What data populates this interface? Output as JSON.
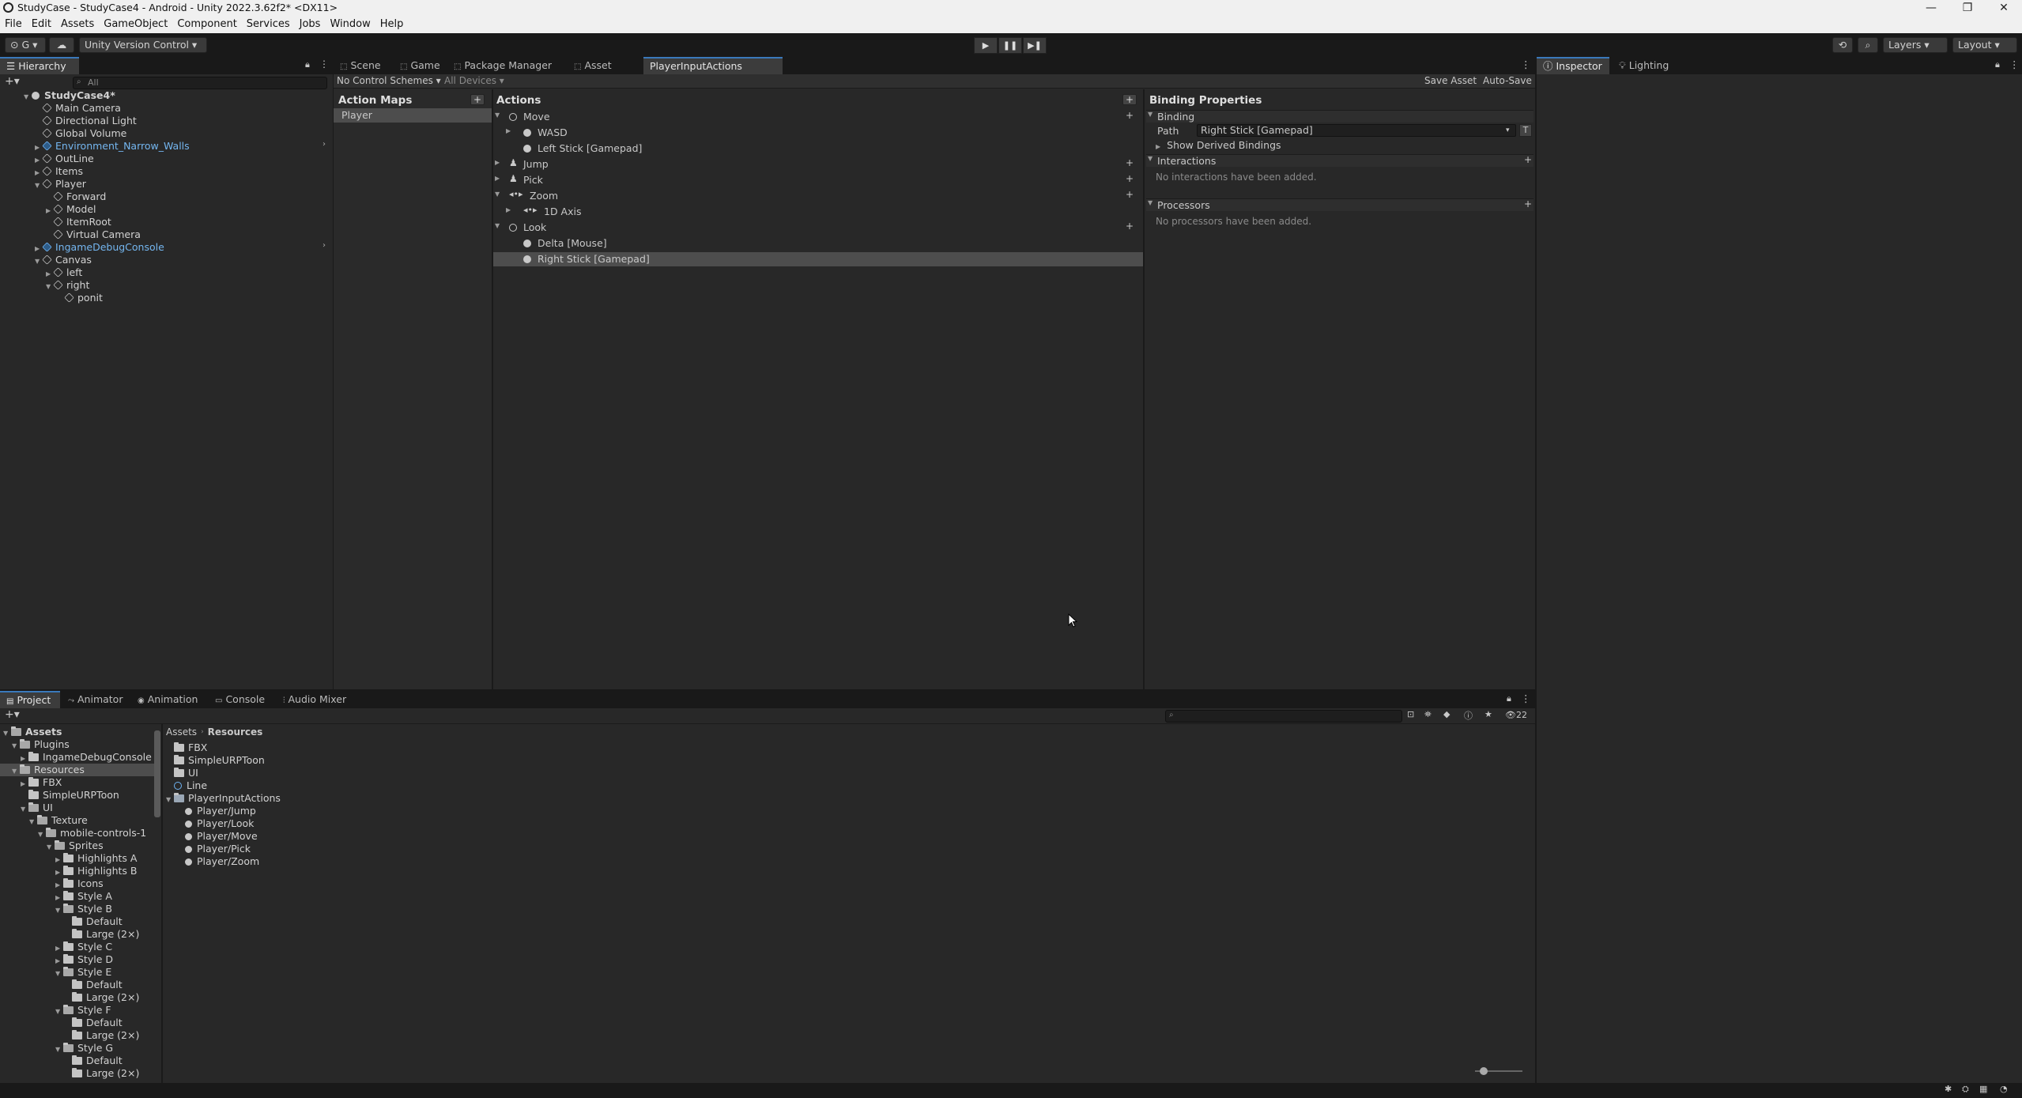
{
  "window": {
    "title": "StudyCase - StudyCase4 - Android - Unity 2022.3.62f2* <DX11>",
    "minimize": "—",
    "maximize": "❐",
    "close": "✕"
  },
  "menu": [
    "File",
    "Edit",
    "Assets",
    "GameObject",
    "Component",
    "Services",
    "Jobs",
    "Window",
    "Help"
  ],
  "toolbar": {
    "account": "G",
    "version_control": "Unity Version Control",
    "play": "▶",
    "pause": "❚❚",
    "step": "▶❚",
    "layers": "Layers",
    "layout": "Layout"
  },
  "hierarchy": {
    "tab": "Hierarchy",
    "search_placeholder": "All",
    "scene": "StudyCase4*",
    "items": [
      {
        "label": "Main Camera",
        "depth": 1,
        "arrow": "",
        "blue": false
      },
      {
        "label": "Directional Light",
        "depth": 1,
        "arrow": "",
        "blue": false
      },
      {
        "label": "Global Volume",
        "depth": 1,
        "arrow": "",
        "blue": false
      },
      {
        "label": "Environment_Narrow_Walls",
        "depth": 1,
        "arrow": "▶",
        "blue": true
      },
      {
        "label": "OutLine",
        "depth": 1,
        "arrow": "▶",
        "blue": false
      },
      {
        "label": "Items",
        "depth": 1,
        "arrow": "▶",
        "blue": false
      },
      {
        "label": "Player",
        "depth": 1,
        "arrow": "▼",
        "blue": false
      },
      {
        "label": "Forward",
        "depth": 2,
        "arrow": "",
        "blue": false
      },
      {
        "label": "Model",
        "depth": 2,
        "arrow": "▶",
        "blue": false
      },
      {
        "label": "ItemRoot",
        "depth": 2,
        "arrow": "",
        "blue": false
      },
      {
        "label": "Virtual Camera",
        "depth": 2,
        "arrow": "",
        "blue": false
      },
      {
        "label": "IngameDebugConsole",
        "depth": 1,
        "arrow": "▶",
        "blue": true
      },
      {
        "label": "Canvas",
        "depth": 1,
        "arrow": "▼",
        "blue": false
      },
      {
        "label": "left",
        "depth": 2,
        "arrow": "▶",
        "blue": false
      },
      {
        "label": "right",
        "depth": 2,
        "arrow": "▼",
        "blue": false
      },
      {
        "label": "ponit",
        "depth": 3,
        "arrow": "",
        "blue": false
      }
    ]
  },
  "center_tabs": [
    "Scene",
    "Game",
    "Package Manager",
    "Asset Store",
    "PlayerInputActions (Input..."
  ],
  "input_editor": {
    "control_schemes": "No Control Schemes",
    "devices": "All Devices",
    "save_asset": "Save Asset",
    "auto_save": "Auto-Save",
    "action_maps_title": "Action Maps",
    "action_maps": [
      "Player"
    ],
    "actions_title": "Actions",
    "actions": [
      {
        "label": "Move",
        "depth": 0,
        "arrow": "▼",
        "kind": "action",
        "plus": true
      },
      {
        "label": "WASD",
        "depth": 1,
        "arrow": "▶",
        "kind": "binding",
        "plus": false
      },
      {
        "label": "Left Stick [Gamepad]",
        "depth": 1,
        "arrow": "",
        "kind": "binding",
        "plus": false
      },
      {
        "label": "Jump",
        "depth": 0,
        "arrow": "▶",
        "kind": "button",
        "plus": true
      },
      {
        "label": "Pick",
        "depth": 0,
        "arrow": "▶",
        "kind": "button",
        "plus": true
      },
      {
        "label": "Zoom",
        "depth": 0,
        "arrow": "▼",
        "kind": "axis",
        "plus": true
      },
      {
        "label": "1D Axis",
        "depth": 1,
        "arrow": "▶",
        "kind": "axis",
        "plus": false
      },
      {
        "label": "Look",
        "depth": 0,
        "arrow": "▼",
        "kind": "action",
        "plus": true
      },
      {
        "label": "Delta [Mouse]",
        "depth": 1,
        "arrow": "",
        "kind": "binding",
        "plus": false
      },
      {
        "label": "Right Stick [Gamepad]",
        "depth": 1,
        "arrow": "",
        "kind": "binding",
        "plus": false,
        "selected": true
      }
    ],
    "binding_props_title": "Binding Properties",
    "binding_section": "Binding",
    "path_label": "Path",
    "path_value": "Right Stick [Gamepad]",
    "t_button": "T",
    "show_derived": "Show Derived Bindings",
    "interactions": "Interactions",
    "no_interactions": "No interactions have been added.",
    "processors": "Processors",
    "no_processors": "No processors have been added."
  },
  "right_tabs": [
    "Inspector",
    "Lighting"
  ],
  "bottom_tabs": [
    "Project",
    "Animator",
    "Animation",
    "Console",
    "Audio Mixer"
  ],
  "project": {
    "hidden_count": "22",
    "tree": [
      {
        "label": "Assets",
        "depth": 0,
        "arrow": "▼",
        "bold": true
      },
      {
        "label": "Plugins",
        "depth": 1,
        "arrow": "▼"
      },
      {
        "label": "IngameDebugConsole",
        "depth": 2,
        "arrow": "▶"
      },
      {
        "label": "Resources",
        "depth": 1,
        "arrow": "▼",
        "selected": true
      },
      {
        "label": "FBX",
        "depth": 2,
        "arrow": "▶"
      },
      {
        "label": "SimpleURPToon",
        "depth": 2,
        "arrow": ""
      },
      {
        "label": "UI",
        "depth": 2,
        "arrow": "▼"
      },
      {
        "label": "Texture",
        "depth": 3,
        "arrow": "▼"
      },
      {
        "label": "mobile-controls-1",
        "depth": 4,
        "arrow": "▼"
      },
      {
        "label": "Sprites",
        "depth": 5,
        "arrow": "▼"
      },
      {
        "label": "Highlights A",
        "depth": 6,
        "arrow": "▶"
      },
      {
        "label": "Highlights B",
        "depth": 6,
        "arrow": "▶"
      },
      {
        "label": "Icons",
        "depth": 6,
        "arrow": "▶"
      },
      {
        "label": "Style A",
        "depth": 6,
        "arrow": "▶"
      },
      {
        "label": "Style B",
        "depth": 6,
        "arrow": "▼"
      },
      {
        "label": "Default",
        "depth": 7,
        "arrow": ""
      },
      {
        "label": "Large (2×)",
        "depth": 7,
        "arrow": ""
      },
      {
        "label": "Style C",
        "depth": 6,
        "arrow": "▶"
      },
      {
        "label": "Style D",
        "depth": 6,
        "arrow": "▶"
      },
      {
        "label": "Style E",
        "depth": 6,
        "arrow": "▼"
      },
      {
        "label": "Default",
        "depth": 7,
        "arrow": ""
      },
      {
        "label": "Large (2×)",
        "depth": 7,
        "arrow": ""
      },
      {
        "label": "Style F",
        "depth": 6,
        "arrow": "▼"
      },
      {
        "label": "Default",
        "depth": 7,
        "arrow": ""
      },
      {
        "label": "Large (2×)",
        "depth": 7,
        "arrow": ""
      },
      {
        "label": "Style G",
        "depth": 6,
        "arrow": "▼"
      },
      {
        "label": "Default",
        "depth": 7,
        "arrow": ""
      },
      {
        "label": "Large (2×)",
        "depth": 7,
        "arrow": ""
      }
    ],
    "breadcrumb": [
      "Assets",
      "Resources"
    ],
    "files": [
      {
        "label": "FBX",
        "type": "folder",
        "depth": 0
      },
      {
        "label": "SimpleURPToon",
        "type": "folder",
        "depth": 0
      },
      {
        "label": "UI",
        "type": "folder",
        "depth": 0
      },
      {
        "label": "Line",
        "type": "asset",
        "depth": 0
      },
      {
        "label": "PlayerInputActions",
        "type": "inputactions",
        "depth": 0,
        "arrow": "▼"
      },
      {
        "label": "Player/Jump",
        "type": "action",
        "depth": 1
      },
      {
        "label": "Player/Look",
        "type": "action",
        "depth": 1
      },
      {
        "label": "Player/Move",
        "type": "action",
        "depth": 1
      },
      {
        "label": "Player/Pick",
        "type": "action",
        "depth": 1
      },
      {
        "label": "Player/Zoom",
        "type": "action",
        "depth": 1
      }
    ]
  },
  "colors": {
    "selection": "#4d4d4d",
    "accent": "#3a79bb",
    "prefab_blue": "#6fb3f2"
  }
}
